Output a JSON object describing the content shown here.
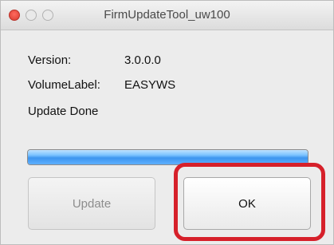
{
  "window": {
    "title": "FirmUpdateTool_uw100"
  },
  "info": {
    "version_label": "Version:",
    "version_value": "3.0.0.0",
    "volume_label": "VolumeLabel:",
    "volume_value": "EASYWS",
    "status": "Update Done"
  },
  "progress": {
    "value_percent": 100
  },
  "buttons": {
    "update_label": "Update",
    "update_enabled": false,
    "ok_label": "OK"
  },
  "colors": {
    "highlight": "#d6202a",
    "progress_fill": "#3d95ef"
  }
}
